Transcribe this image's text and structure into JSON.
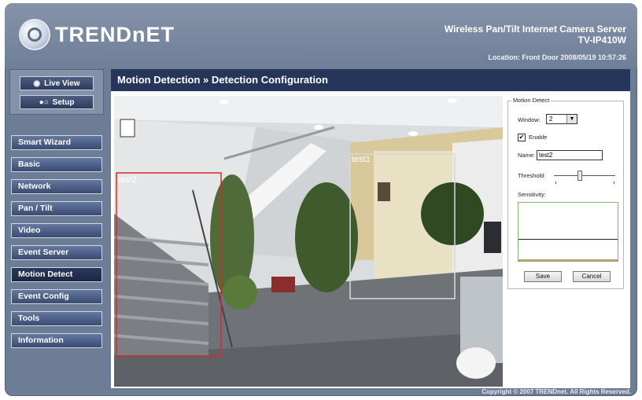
{
  "header": {
    "logo_text": "TRENDnET",
    "product_title": "Wireless Pan/Tilt Internet Camera Server",
    "model": "TV-IP410W",
    "location_line": "Location: Front Door   2008/05/19 10:57:26"
  },
  "sidebar": {
    "live_view": "Live View",
    "setup": "Setup",
    "items": [
      {
        "label": "Smart Wizard"
      },
      {
        "label": "Basic"
      },
      {
        "label": "Network"
      },
      {
        "label": "Pan / Tilt"
      },
      {
        "label": "Video"
      },
      {
        "label": "Event Server"
      },
      {
        "label": "Motion Detect"
      },
      {
        "label": "Event Config"
      },
      {
        "label": "Tools"
      },
      {
        "label": "Information"
      }
    ],
    "active_index": 6
  },
  "main": {
    "title": "Motion Detection » Detection Configuration",
    "windows": [
      {
        "label": "test1",
        "color": "#d9d9d9"
      },
      {
        "label": "test2",
        "color": "#d42a2a"
      }
    ]
  },
  "panel": {
    "legend": "Motion Detect",
    "window_label": "Window:",
    "window_value": "2",
    "enable_label": "Enable",
    "enable_checked": true,
    "name_label": "Name:",
    "name_value": "test2",
    "threshold_label": "Threshold:",
    "sensitivity_label": "Sensitivity:",
    "save": "Save",
    "cancel": "Cancel"
  },
  "footer": {
    "copyright": "Copyright © 2007 TRENDnet. All Rights Reserved."
  },
  "colors": {
    "frame": "#6d7d95",
    "title_bar": "#25365a",
    "nav_button": "#4b5d83"
  }
}
